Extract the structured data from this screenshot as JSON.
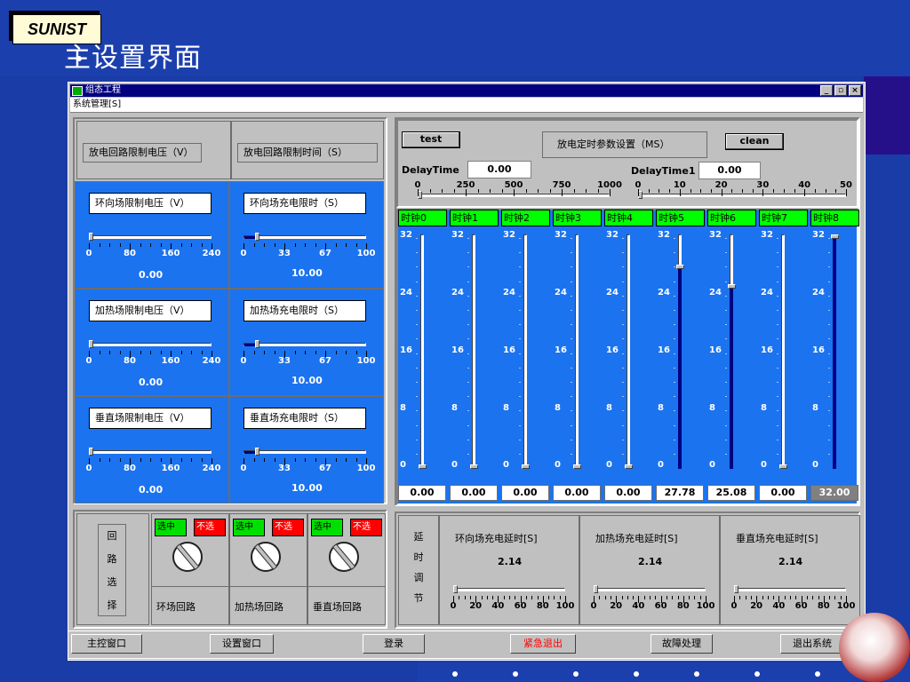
{
  "slide": {
    "logo": "SUNIST",
    "title": "主设置界面"
  },
  "window": {
    "title": "组态工程",
    "menu": "系统管理[S]",
    "min": "_",
    "restore": "▫",
    "close": "×"
  },
  "left_panel": {
    "discharge_voltage_label": "放电回路限制电压（V）",
    "discharge_time_label": "放电回路限制时间（S）",
    "rows": [
      {
        "voltage_label": "环向场限制电压（V）",
        "voltage_value": "0.00",
        "voltage_fraction": 0.0,
        "time_label": "环向场充电限时（S）",
        "time_value": "10.00",
        "time_fraction": 0.1
      },
      {
        "voltage_label": "加热场限制电压（V）",
        "voltage_value": "0.00",
        "voltage_fraction": 0.0,
        "time_label": "加热场充电限时（S）",
        "time_value": "10.00",
        "time_fraction": 0.1
      },
      {
        "voltage_label": "垂直场限制电压（V）",
        "voltage_value": "0.00",
        "voltage_fraction": 0.0,
        "time_label": "垂直场充电限时（S）",
        "time_value": "10.00",
        "time_fraction": 0.1
      }
    ],
    "voltage_ticks": [
      "0",
      "80",
      "160",
      "240"
    ],
    "time_ticks": [
      "0",
      "33",
      "67",
      "100"
    ]
  },
  "right_panel": {
    "test_label": "test",
    "clean_label": "clean",
    "param_title": "放电定时参数设置（MS）",
    "delay1": {
      "label": "DelayTime",
      "value": "0.00",
      "ticks": [
        "0",
        "250",
        "500",
        "750",
        "1000"
      ]
    },
    "delay2": {
      "label": "DelayTime1",
      "value": "0.00",
      "ticks": [
        "0",
        "10",
        "20",
        "30",
        "40",
        "50"
      ]
    },
    "scale_labels": [
      "32",
      "24",
      "16",
      "8",
      "0"
    ],
    "clocks": [
      {
        "name": "时钟0",
        "value": "0.00",
        "level": 0.0
      },
      {
        "name": "时钟1",
        "value": "0.00",
        "level": 0.0
      },
      {
        "name": "时钟2",
        "value": "0.00",
        "level": 0.0
      },
      {
        "name": "时钟3",
        "value": "0.00",
        "level": 0.0
      },
      {
        "name": "时钟4",
        "value": "0.00",
        "level": 0.0
      },
      {
        "name": "时钟5",
        "value": "27.78",
        "level": 0.868
      },
      {
        "name": "时钟6",
        "value": "25.08",
        "level": 0.784
      },
      {
        "name": "时钟7",
        "value": "0.00",
        "level": 0.0
      },
      {
        "name": "时钟8",
        "value": "32.00",
        "level": 1.0
      }
    ]
  },
  "loop_panel": {
    "side_label": [
      "回",
      "路",
      "选",
      "择"
    ],
    "selected": "选中",
    "unselected": "不选",
    "loops": [
      "环场回路",
      "加热场回路",
      "垂直场回路"
    ]
  },
  "delay_panel": {
    "side_label": [
      "延",
      "时",
      "调",
      "节"
    ],
    "items": [
      {
        "label": "环向场充电延时[S]",
        "value": "2.14"
      },
      {
        "label": "加热场充电延时[S]",
        "value": "2.14"
      },
      {
        "label": "垂直场充电延时[S]",
        "value": "2.14"
      }
    ],
    "ticks": [
      "0",
      "20",
      "40",
      "60",
      "80",
      "100"
    ]
  },
  "tabs": [
    {
      "label": "主控窗口",
      "color": "#000000"
    },
    {
      "label": "设置窗口",
      "color": "#000000"
    },
    {
      "label": "登录",
      "color": "#000000"
    },
    {
      "label": "紧急退出",
      "color": "#ff0000"
    },
    {
      "label": "故障处理",
      "color": "#000000"
    },
    {
      "label": "退出系统",
      "color": "#000000"
    }
  ],
  "colors": {
    "panel_blue": "#1b73f0",
    "clock_header": "#00ff00",
    "title_bar": "#000080",
    "slide_blue": "#1a3ca6"
  }
}
